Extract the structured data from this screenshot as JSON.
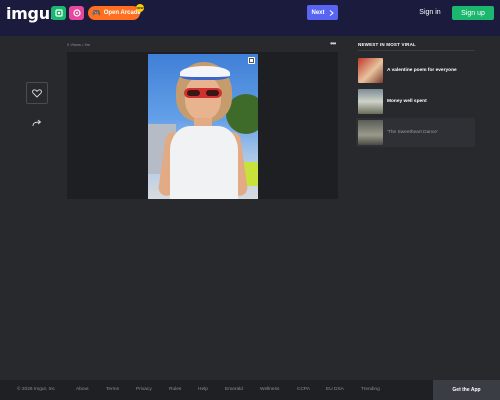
{
  "header": {
    "logo": "imgur",
    "app_icons": [
      {
        "name": "green-app-icon",
        "glyph": "▣",
        "color": "#1bb76e"
      },
      {
        "name": "pink-app-icon",
        "glyph": "◉",
        "color": "#e6489d"
      }
    ],
    "arcade_label": "Open Arcade",
    "arcade_badge": "NEW",
    "next_label": "Next",
    "signin_label": "Sign in",
    "signup_label": "Sign up"
  },
  "post": {
    "meta": "0 Views • 9m",
    "menu_glyph": "•••"
  },
  "viral": {
    "title": "NEWEST IN MOST VIRAL",
    "items": [
      {
        "label": "A valentine poem for everyone"
      },
      {
        "label": "Money well spent"
      },
      {
        "label": "'The Sweetheart Dance'"
      }
    ]
  },
  "footer": {
    "links": [
      "© 2026 Imgur, Inc",
      "About",
      "Terms",
      "Privacy",
      "Rules",
      "Help",
      "Emerald",
      "Wellness",
      "CCPA",
      "EU DSA",
      "Trending"
    ],
    "get_app": "Get the App"
  },
  "colors": {
    "background": "#27292d",
    "header": "#1b1b3d",
    "next_button": "#5865f2",
    "signup_button": "#1bb76e",
    "arcade_button": "#ff6f1f"
  }
}
